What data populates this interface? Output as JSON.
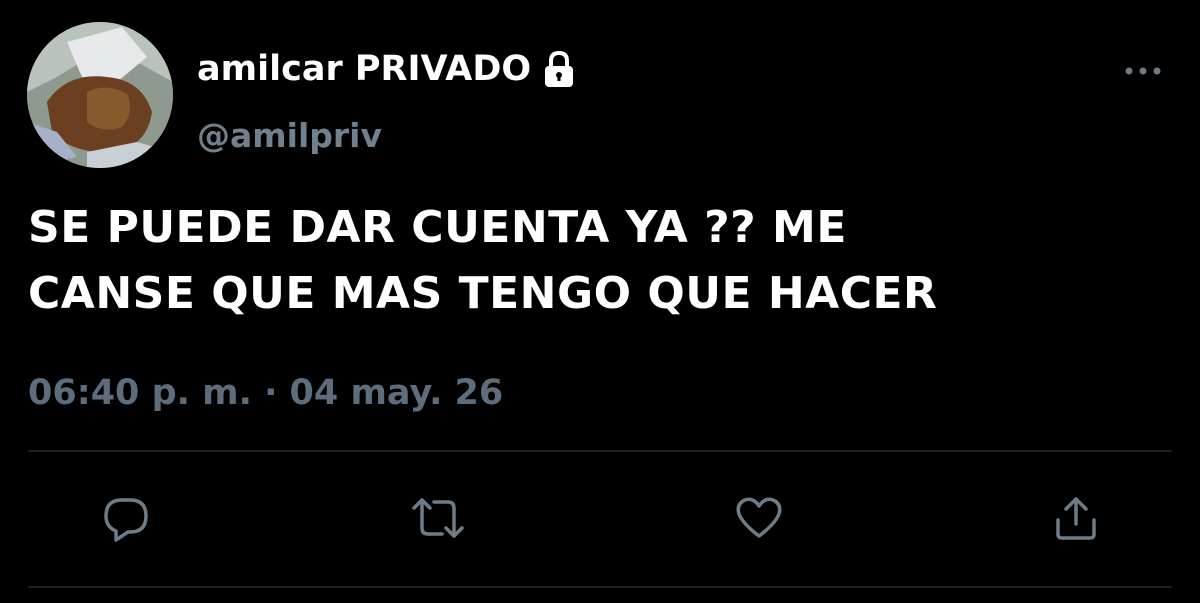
{
  "user": {
    "display_name": "amilcar PRIVADO",
    "handle": "@amilpriv",
    "protected_icon": "lock-icon",
    "avatar_icon": "avatar-photo"
  },
  "tweet": {
    "lines": [
      "SE PUEDE DAR CUENTA YA ?? ME",
      "CANSE QUE MAS TENGO QUE HACER"
    ],
    "timestamp": "06:40 p. m. · 04 may. 26"
  },
  "actions": [
    {
      "name": "reply",
      "icon": "reply-icon"
    },
    {
      "name": "retweet",
      "icon": "retweet-icon"
    },
    {
      "name": "like",
      "icon": "heart-icon"
    },
    {
      "name": "share",
      "icon": "share-icon"
    }
  ],
  "menu": {
    "icon": "more-options-icon"
  },
  "colors": {
    "background": "#000000",
    "text": "#ffffff",
    "secondary_text": "#71808d",
    "icon": "#6e7c88",
    "divider": "#1c2126"
  }
}
